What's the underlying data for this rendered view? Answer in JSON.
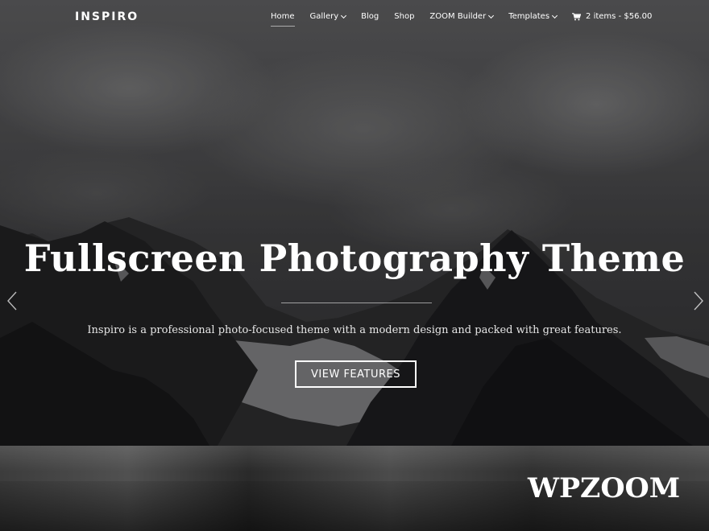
{
  "header": {
    "logo": "INSPIRO",
    "nav": [
      {
        "label": "Home",
        "active": true,
        "dropdown": false
      },
      {
        "label": "Gallery",
        "active": false,
        "dropdown": true
      },
      {
        "label": "Blog",
        "active": false,
        "dropdown": false
      },
      {
        "label": "Shop",
        "active": false,
        "dropdown": false
      },
      {
        "label": "ZOOM Builder",
        "active": false,
        "dropdown": true
      },
      {
        "label": "Templates",
        "active": false,
        "dropdown": true
      }
    ],
    "cart": {
      "icon": "cart-icon",
      "label": "2 items - $56.00"
    }
  },
  "hero": {
    "title": "Fullscreen Photography Theme",
    "subtitle": "Inspiro is a professional photo-focused theme with a modern design and packed with great features.",
    "button": "VIEW FEATURES",
    "prev_icon": "chevron-left-icon",
    "next_icon": "chevron-right-icon"
  },
  "footer": {
    "brand": "WPZOOM"
  }
}
